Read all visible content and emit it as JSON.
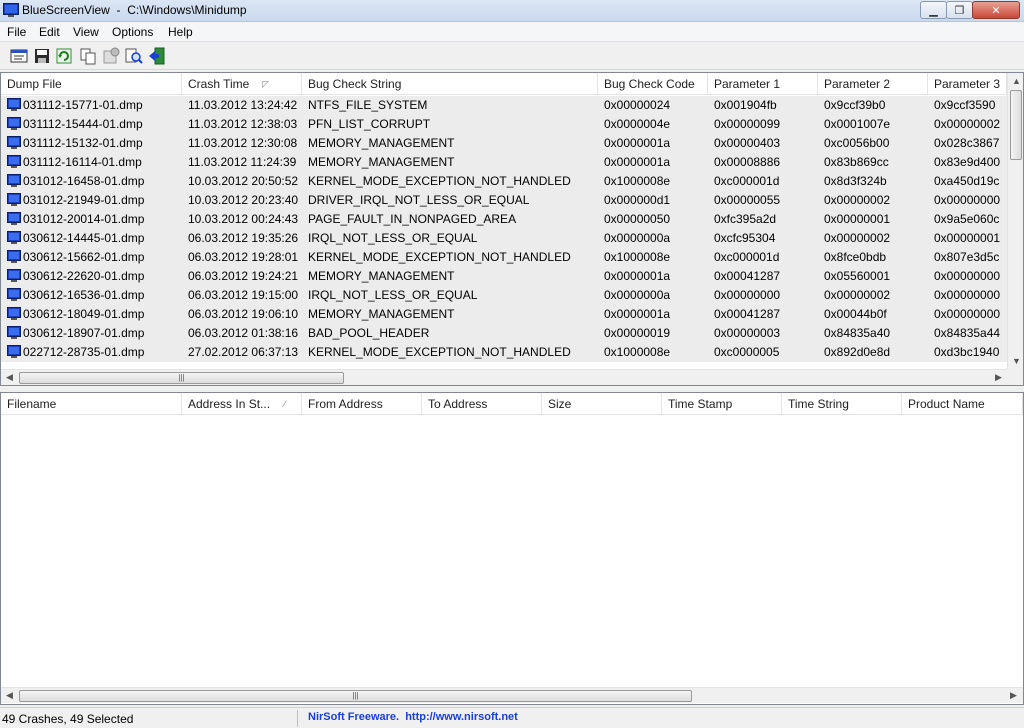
{
  "window": {
    "app_name": "BlueScreenView",
    "path": "C:\\Windows\\Minidump",
    "title_separator": "  -  "
  },
  "menu": [
    "File",
    "Edit",
    "View",
    "Options",
    "Help"
  ],
  "toolbar": {
    "buttons": [
      "properties-icon",
      "save-icon",
      "refresh-icon",
      "copy-icon",
      "advanced-options-icon",
      "find-icon",
      "exit-icon"
    ]
  },
  "crash_list": {
    "columns": [
      "Dump File",
      "Crash Time",
      "Bug Check String",
      "Bug Check Code",
      "Parameter 1",
      "Parameter 2",
      "Parameter 3"
    ],
    "sorted_column": "Crash Time",
    "rows": [
      [
        "031112-15771-01.dmp",
        "11.03.2012 13:24:42",
        "NTFS_FILE_SYSTEM",
        "0x00000024",
        "0x001904fb",
        "0x9ccf39b0",
        "0x9ccf3590"
      ],
      [
        "031112-15444-01.dmp",
        "11.03.2012 12:38:03",
        "PFN_LIST_CORRUPT",
        "0x0000004e",
        "0x00000099",
        "0x0001007e",
        "0x00000002"
      ],
      [
        "031112-15132-01.dmp",
        "11.03.2012 12:30:08",
        "MEMORY_MANAGEMENT",
        "0x0000001a",
        "0x00000403",
        "0xc0056b00",
        "0x028c3867"
      ],
      [
        "031112-16114-01.dmp",
        "11.03.2012 11:24:39",
        "MEMORY_MANAGEMENT",
        "0x0000001a",
        "0x00008886",
        "0x83b869cc",
        "0x83e9d400"
      ],
      [
        "031012-16458-01.dmp",
        "10.03.2012 20:50:52",
        "KERNEL_MODE_EXCEPTION_NOT_HANDLED",
        "0x1000008e",
        "0xc000001d",
        "0x8d3f324b",
        "0xa450d19c"
      ],
      [
        "031012-21949-01.dmp",
        "10.03.2012 20:23:40",
        "DRIVER_IRQL_NOT_LESS_OR_EQUAL",
        "0x000000d1",
        "0x00000055",
        "0x00000002",
        "0x00000000"
      ],
      [
        "031012-20014-01.dmp",
        "10.03.2012 00:24:43",
        "PAGE_FAULT_IN_NONPAGED_AREA",
        "0x00000050",
        "0xfc395a2d",
        "0x00000001",
        "0x9a5e060c"
      ],
      [
        "030612-14445-01.dmp",
        "06.03.2012 19:35:26",
        "IRQL_NOT_LESS_OR_EQUAL",
        "0x0000000a",
        "0xcfc95304",
        "0x00000002",
        "0x00000001"
      ],
      [
        "030612-15662-01.dmp",
        "06.03.2012 19:28:01",
        "KERNEL_MODE_EXCEPTION_NOT_HANDLED",
        "0x1000008e",
        "0xc000001d",
        "0x8fce0bdb",
        "0x807e3d5c"
      ],
      [
        "030612-22620-01.dmp",
        "06.03.2012 19:24:21",
        "MEMORY_MANAGEMENT",
        "0x0000001a",
        "0x00041287",
        "0x05560001",
        "0x00000000"
      ],
      [
        "030612-16536-01.dmp",
        "06.03.2012 19:15:00",
        "IRQL_NOT_LESS_OR_EQUAL",
        "0x0000000a",
        "0x00000000",
        "0x00000002",
        "0x00000000"
      ],
      [
        "030612-18049-01.dmp",
        "06.03.2012 19:06:10",
        "MEMORY_MANAGEMENT",
        "0x0000001a",
        "0x00041287",
        "0x00044b0f",
        "0x00000000"
      ],
      [
        "030612-18907-01.dmp",
        "06.03.2012 01:38:16",
        "BAD_POOL_HEADER",
        "0x00000019",
        "0x00000003",
        "0x84835a40",
        "0x84835a44"
      ],
      [
        "022712-28735-01.dmp",
        "27.02.2012 06:37:13",
        "KERNEL_MODE_EXCEPTION_NOT_HANDLED",
        "0x1000008e",
        "0xc0000005",
        "0x892d0e8d",
        "0xd3bc1940"
      ]
    ]
  },
  "driver_list": {
    "columns": [
      "Filename",
      "Address In St...",
      "From Address",
      "To Address",
      "Size",
      "Time Stamp",
      "Time String",
      "Product Name"
    ],
    "rows": []
  },
  "status": {
    "count_text": "49 Crashes, 49 Selected",
    "link_text": "NirSoft Freeware.  http://www.nirsoft.net"
  },
  "colors": {
    "link": "#1a3fd6",
    "row_selected_bg": "#ececec",
    "title_bar": "#c9d9ee"
  }
}
